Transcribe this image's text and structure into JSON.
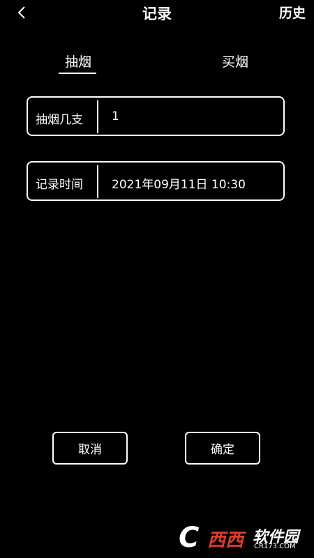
{
  "header": {
    "title": "记录",
    "history_label": "历史",
    "back_icon": "chevron-left-icon"
  },
  "tabs": [
    {
      "label": "抽烟",
      "selected": true
    },
    {
      "label": "买烟",
      "selected": false
    }
  ],
  "form": {
    "count": {
      "label": "抽烟几支",
      "value": "1"
    },
    "time": {
      "label": "记录时间",
      "value": "2021年09月11日 10:30"
    }
  },
  "buttons": {
    "cancel": "取消",
    "confirm": "确定"
  },
  "watermark": {
    "mark": "C",
    "red_text": "西西",
    "text": "软件园",
    "url": "CR173.COM"
  },
  "colors": {
    "background": "#000000",
    "foreground": "#ffffff",
    "watermark_red": "#e63a2e"
  }
}
